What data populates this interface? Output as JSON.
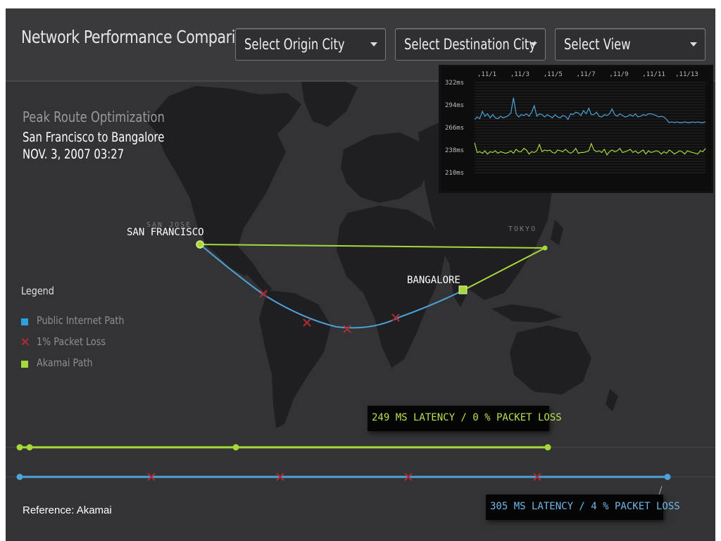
{
  "header": {
    "title": "Network Performance Comparison",
    "dropdowns": {
      "origin": "Select Origin City",
      "destination": "Select Destination City",
      "view": "Select View"
    }
  },
  "route": {
    "heading": "Peak Route Optimization",
    "name": "San Francisco to Bangalore",
    "datetime": "NOV. 3, 2007 03:27"
  },
  "cities": {
    "san_francisco": "SAN FRANCISCO",
    "san_jose": "SAN JOSE",
    "tokyo": "TOKYO",
    "bangalore": "BANGALORE"
  },
  "legend": {
    "title": "Legend",
    "items": [
      {
        "label": "Public Internet Path",
        "color": "#2d9fe0",
        "icon": "square"
      },
      {
        "label": "1% Packet Loss",
        "color": "#b02a33",
        "icon": "x"
      },
      {
        "label": "Akamai Path",
        "color": "#a6d83a",
        "icon": "square"
      }
    ]
  },
  "colors": {
    "akamai": "#a6d83a",
    "public": "#4aa3d9",
    "loss": "#b02a33",
    "background": "#333335"
  },
  "timeline": {
    "akamai_callout": "249 MS LATENCY / 0 % PACKET LOSS",
    "public_callout": "305 MS LATENCY / 4 % PACKET LOSS",
    "akamai_packet_loss_markers": 0,
    "public_packet_loss_markers": 4
  },
  "reference": "Reference: Akamai",
  "chart_data": {
    "type": "line",
    "title": "",
    "x": [
      "11/1",
      "11/3",
      "11/5",
      "11/7",
      "11/9",
      "11/11",
      "11/13"
    ],
    "y_ticks": [
      "322ms",
      "294ms",
      "266ms",
      "238ms",
      "210ms"
    ],
    "ylim": [
      210,
      322
    ],
    "grid": true,
    "series": [
      {
        "color": "#4aa3d9",
        "values": [
          276,
          279,
          277,
          286,
          280,
          283,
          278,
          282,
          278,
          277,
          280,
          278,
          279,
          281,
          284,
          303,
          283,
          279,
          282,
          281,
          283,
          280,
          285,
          293,
          280,
          283,
          282,
          279,
          282,
          280,
          278,
          282,
          279,
          278,
          281,
          280,
          276,
          283,
          282,
          285,
          284,
          281,
          287,
          283,
          290,
          282,
          282,
          285,
          280,
          279,
          282,
          281,
          283,
          289,
          282,
          280,
          283,
          281,
          279,
          280,
          282,
          280,
          283,
          279,
          280,
          282,
          281,
          283,
          283,
          282,
          281,
          279,
          280,
          279,
          276,
          272,
          273,
          272,
          273,
          272,
          272,
          273,
          272,
          272,
          273,
          272,
          273,
          272,
          272,
          273
        ]
      },
      {
        "color": "#a6d83a",
        "values": [
          247,
          235,
          236,
          234,
          237,
          233,
          236,
          235,
          237,
          234,
          236,
          235,
          234,
          235,
          237,
          234,
          239,
          236,
          236,
          240,
          238,
          233,
          236,
          235,
          237,
          245,
          236,
          238,
          237,
          238,
          235,
          234,
          238,
          237,
          236,
          239,
          236,
          234,
          236,
          240,
          234,
          235,
          235,
          236,
          237,
          246,
          238,
          236,
          237,
          235,
          239,
          232,
          236,
          238,
          236,
          237,
          240,
          235,
          236,
          237,
          239,
          235,
          237,
          234,
          236,
          238,
          233,
          237,
          235,
          236,
          237,
          236,
          233,
          236,
          234,
          238,
          236,
          233,
          235,
          237,
          236,
          233,
          237,
          236,
          235,
          234,
          233,
          237,
          236,
          240
        ]
      }
    ]
  }
}
